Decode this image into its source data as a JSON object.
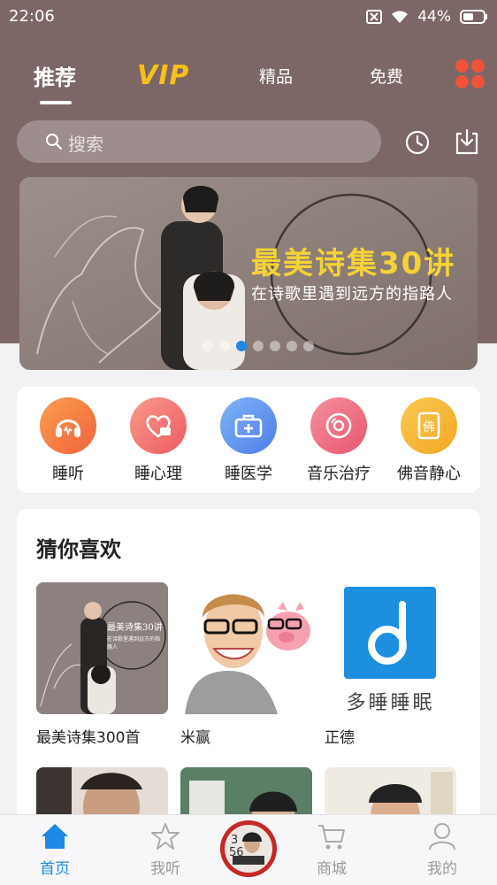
{
  "status": {
    "time": "22:06",
    "battery": "44%"
  },
  "tabs": [
    {
      "label": "推荐"
    },
    {
      "label": "VIP"
    },
    {
      "label": "精品"
    },
    {
      "label": "免费"
    }
  ],
  "search": {
    "placeholder": "搜索"
  },
  "banner": {
    "title": "最美诗集30讲",
    "subtitle": "在诗歌里遇到远方的指路人",
    "dot_count": 7,
    "active_dot": 2
  },
  "categories": [
    {
      "label": "睡听",
      "icon": "headphones-icon",
      "color": "#f47b3e"
    },
    {
      "label": "睡心理",
      "icon": "heart-chat-icon",
      "color": "#f26a6a"
    },
    {
      "label": "睡医学",
      "icon": "medical-kit-icon",
      "color": "#5b8ef0"
    },
    {
      "label": "音乐治疗",
      "icon": "disc-icon",
      "color": "#f06b8b"
    },
    {
      "label": "佛音静心",
      "icon": "buddha-book-icon",
      "color": "#f7b733"
    }
  ],
  "guess": {
    "title": "猜你喜欢",
    "items": [
      {
        "label": "最美诗集300首",
        "cover_title": "最美诗集30讲",
        "cover_sub": "在诗歌里遇到远方的指路人"
      },
      {
        "label": "米赢"
      },
      {
        "label": "正德",
        "cover_title": "多睡睡眠"
      }
    ]
  },
  "bottom_nav": [
    {
      "label": "首页",
      "icon": "home-icon",
      "active": true
    },
    {
      "label": "我听",
      "icon": "star-icon",
      "active": false
    },
    {
      "label": "商城",
      "icon": "cart-icon",
      "active": false
    },
    {
      "label": "我的",
      "icon": "person-icon",
      "active": false
    }
  ],
  "colors": {
    "header": "#7d6766",
    "accent": "#1e88e5",
    "vip": "#f5c01b"
  }
}
